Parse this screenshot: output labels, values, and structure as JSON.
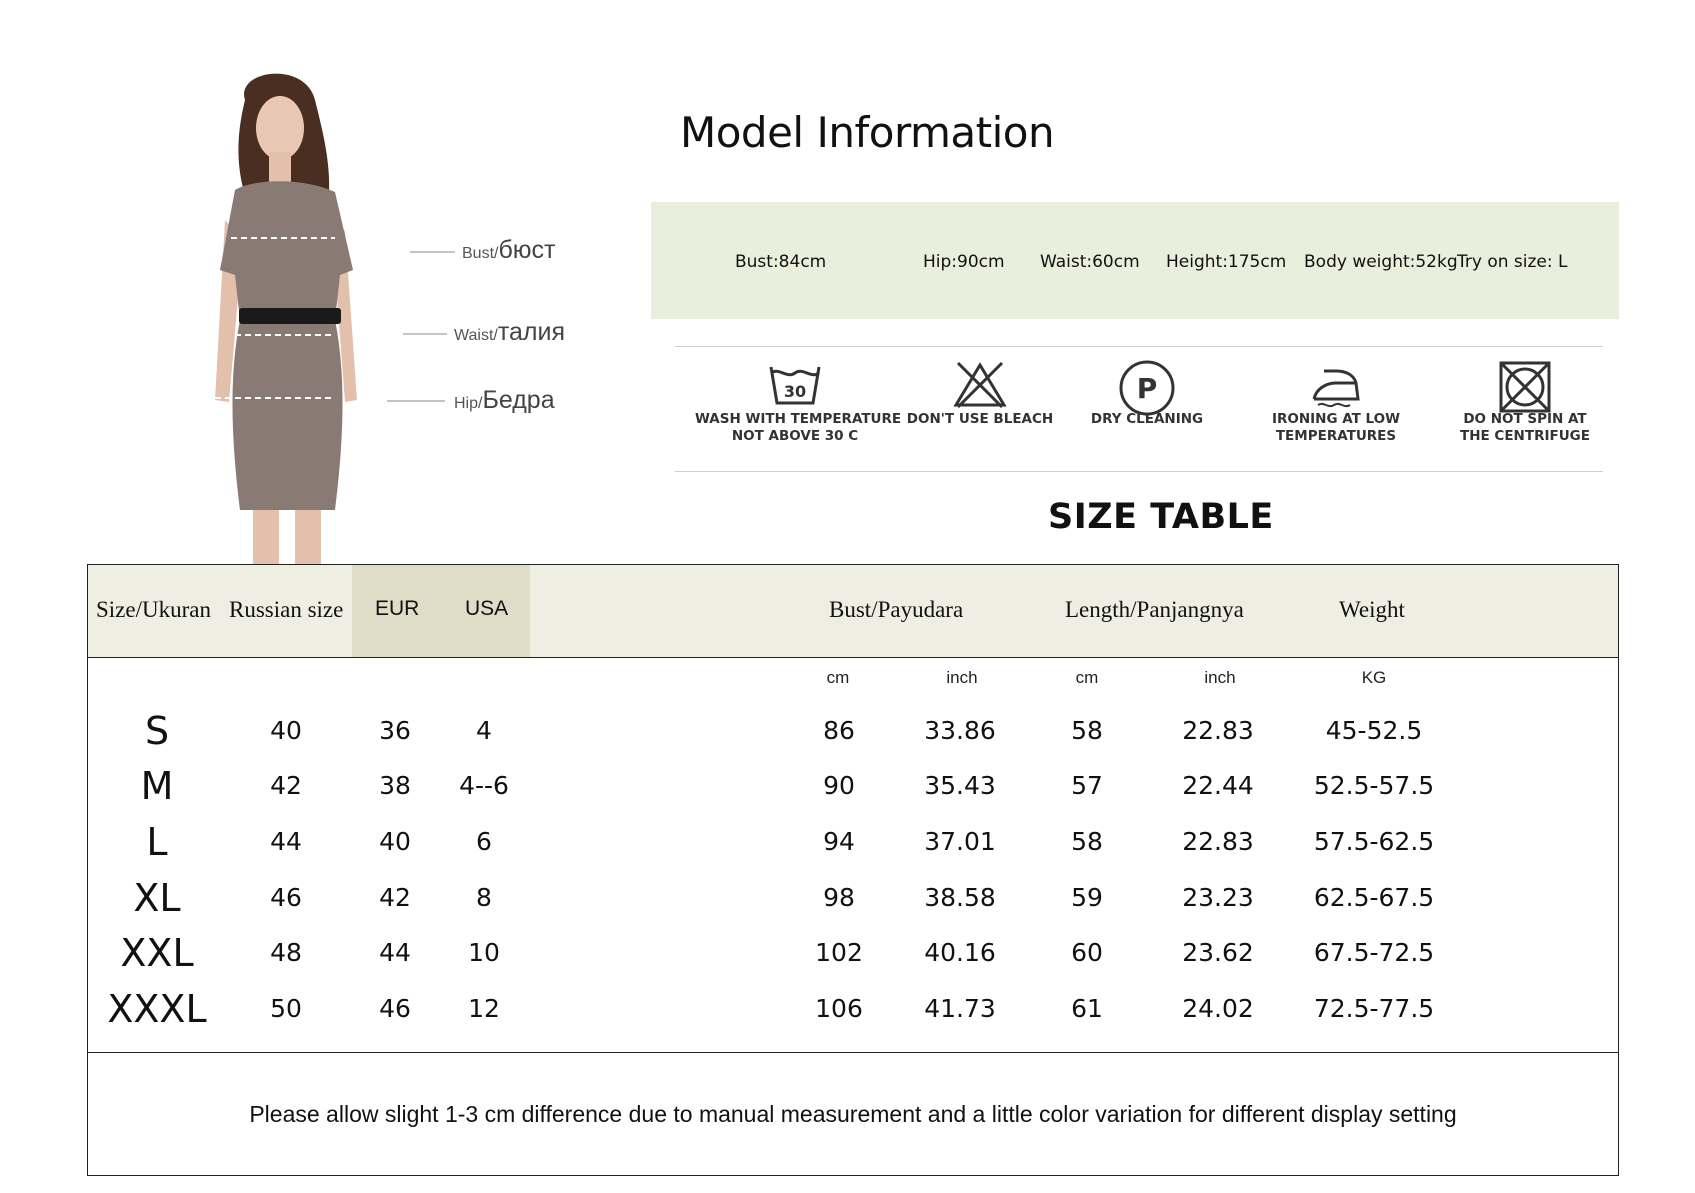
{
  "figure": {
    "measurements": [
      {
        "en": "Bust/",
        "ru": "бюст"
      },
      {
        "en": "Waist/",
        "ru": "талия"
      },
      {
        "en": "Hip/",
        "ru": "Бедра"
      }
    ],
    "dress_color": "#8a7a74",
    "belt_color": "#1a1a1a"
  },
  "model_info": {
    "title": "Model Information",
    "background": "#e9efdc",
    "stats": [
      "Bust:84cm",
      "Hip:90cm",
      "Waist:60cm",
      "Height:175cm",
      "Body weight:52kg",
      "Try on size: L"
    ]
  },
  "care": [
    {
      "icon": "wash-30-icon",
      "number": "30",
      "label_lines": [
        "WASH WITH TEMPERATURE",
        "NOT ABOVE 30 C"
      ]
    },
    {
      "icon": "no-bleach-icon",
      "label_lines": [
        "DON'T USE BLEACH"
      ]
    },
    {
      "icon": "dry-clean-icon",
      "letter": "P",
      "label_lines": [
        "DRY CLEANING"
      ]
    },
    {
      "icon": "iron-low-icon",
      "label_lines": [
        "IRONING AT LOW",
        "TEMPERATURES"
      ]
    },
    {
      "icon": "no-tumble-icon",
      "label_lines": [
        "DO NOT SPIN AT",
        "THE CENTRIFUGE"
      ]
    }
  ],
  "size_table": {
    "title": "SIZE TABLE",
    "header_bg": "#efeee2",
    "highlight_bg": "#dfddc7",
    "headers": {
      "size": "Size/Ukuran",
      "russian": "Russian size",
      "eur": "EUR",
      "usa": "USA",
      "bust": "Bust/Payudara",
      "length": "Length/Panjangnya",
      "weight": "Weight"
    },
    "units": {
      "bust_cm": "cm",
      "bust_inch": "inch",
      "length_cm": "cm",
      "length_inch": "inch",
      "weight": "KG"
    },
    "rows": [
      {
        "size": "S",
        "russian": "40",
        "eur": "36",
        "usa": "4",
        "bust_cm": "86",
        "bust_inch": "33.86",
        "length_cm": "58",
        "length_inch": "22.83",
        "weight": "45-52.5"
      },
      {
        "size": "M",
        "russian": "42",
        "eur": "38",
        "usa": "4--6",
        "bust_cm": "90",
        "bust_inch": "35.43",
        "length_cm": "57",
        "length_inch": "22.44",
        "weight": "52.5-57.5"
      },
      {
        "size": "L",
        "russian": "44",
        "eur": "40",
        "usa": "6",
        "bust_cm": "94",
        "bust_inch": "37.01",
        "length_cm": "58",
        "length_inch": "22.83",
        "weight": "57.5-62.5"
      },
      {
        "size": "XL",
        "russian": "46",
        "eur": "42",
        "usa": "8",
        "bust_cm": "98",
        "bust_inch": "38.58",
        "length_cm": "59",
        "length_inch": "23.23",
        "weight": "62.5-67.5"
      },
      {
        "size": "XXL",
        "russian": "48",
        "eur": "44",
        "usa": "10",
        "bust_cm": "102",
        "bust_inch": "40.16",
        "length_cm": "60",
        "length_inch": "23.62",
        "weight": "67.5-72.5"
      },
      {
        "size": "XXXL",
        "russian": "50",
        "eur": "46",
        "usa": "12",
        "bust_cm": "106",
        "bust_inch": "41.73",
        "length_cm": "61",
        "length_inch": "24.02",
        "weight": "72.5-77.5"
      }
    ],
    "note": "Please allow slight 1-3 cm difference due to manual measurement and a little color variation for different display setting"
  }
}
